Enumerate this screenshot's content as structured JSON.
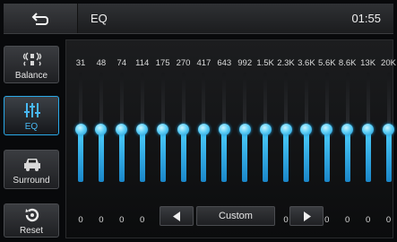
{
  "header": {
    "title": "EQ",
    "clock": "01:55"
  },
  "sidebar": {
    "items": [
      {
        "label": "Balance",
        "icon": "balance-icon",
        "active": false
      },
      {
        "label": "EQ",
        "icon": "eq-sliders-icon",
        "active": true
      },
      {
        "label": "Surround",
        "icon": "car-icon",
        "active": false
      },
      {
        "label": "Reset",
        "icon": "reset-icon",
        "active": false
      }
    ]
  },
  "eq": {
    "bands": [
      {
        "freq": "31",
        "gain": "0"
      },
      {
        "freq": "48",
        "gain": "0"
      },
      {
        "freq": "74",
        "gain": "0"
      },
      {
        "freq": "114",
        "gain": "0"
      },
      {
        "freq": "175",
        "gain": "0"
      },
      {
        "freq": "270",
        "gain": "0"
      },
      {
        "freq": "417",
        "gain": "0"
      },
      {
        "freq": "643",
        "gain": "0"
      },
      {
        "freq": "992",
        "gain": "0"
      },
      {
        "freq": "1.5K",
        "gain": "0"
      },
      {
        "freq": "2.3K",
        "gain": "0"
      },
      {
        "freq": "3.6K",
        "gain": "0"
      },
      {
        "freq": "5.6K",
        "gain": "0"
      },
      {
        "freq": "8.6K",
        "gain": "0"
      },
      {
        "freq": "13K",
        "gain": "0"
      },
      {
        "freq": "20K",
        "gain": "0"
      }
    ],
    "slider_level": 0.5,
    "accent_color": "#2aa9e8"
  },
  "preset": {
    "name": "Custom"
  }
}
